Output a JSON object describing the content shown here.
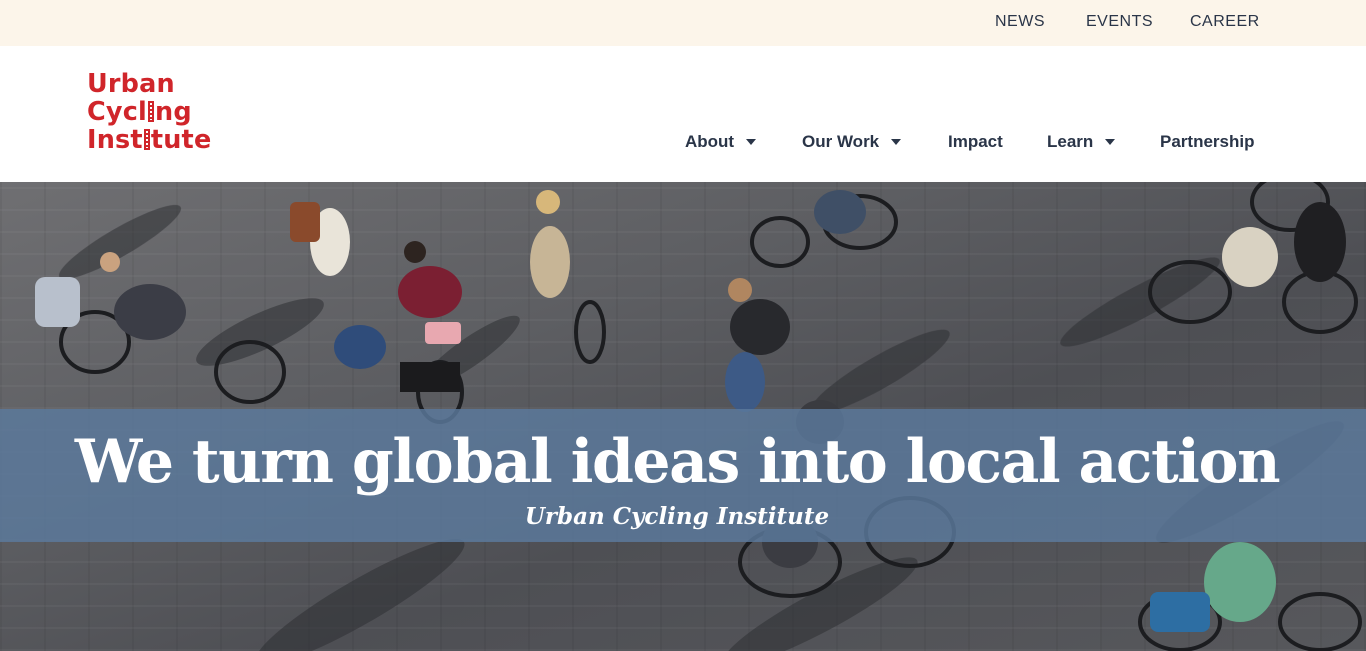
{
  "utility_nav": {
    "news": "NEWS",
    "events": "EVENTS",
    "career": "CAREER"
  },
  "logo": {
    "line1": "Urban",
    "line2_a": "Cycl",
    "line2_b": "ng",
    "line3_a": "Inst",
    "line3_b": "tute",
    "brand_color": "#d0252a"
  },
  "main_nav": {
    "about": "About",
    "our_work": "Our Work",
    "impact": "Impact",
    "learn": "Learn",
    "partnership": "Partnership"
  },
  "hero": {
    "title": "We turn global ideas into local action",
    "subtitle": "Urban Cycling Institute",
    "band_color": "#5c7a9e"
  }
}
